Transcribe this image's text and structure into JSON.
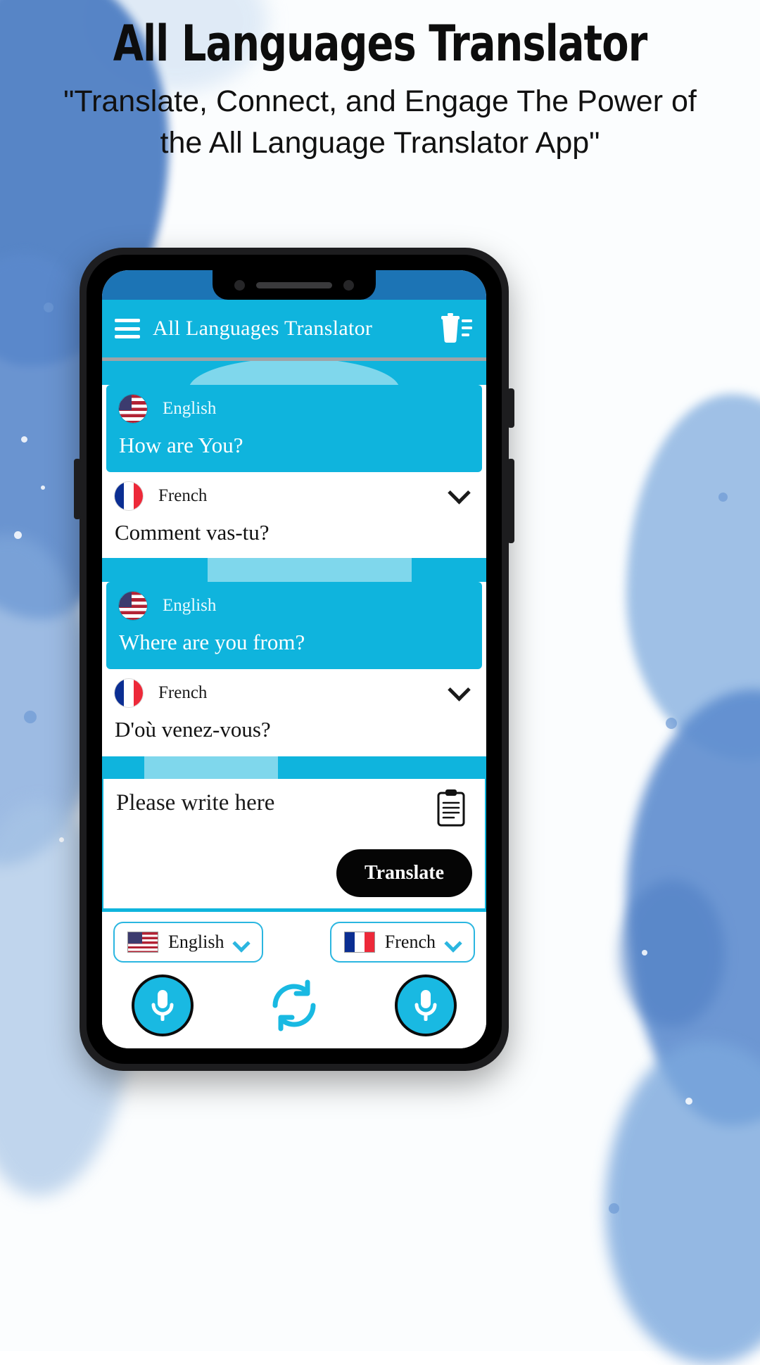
{
  "promo": {
    "title": "All Languages Translator",
    "subtitle": "\"Translate, Connect, and Engage The Power of the All Language Translator App\""
  },
  "app": {
    "bar": {
      "menu_icon": "hamburger-menu-icon",
      "title": "All Languages Translator",
      "delete_all_icon": "trash-list-icon"
    },
    "history": [
      {
        "source": {
          "flag": "us-flag-icon",
          "language": "English",
          "text": "How are You?"
        },
        "target": {
          "flag": "fr-flag-icon",
          "language": "French",
          "text": "Comment vas-tu?",
          "expand_icon": "chevron-down-icon"
        }
      },
      {
        "source": {
          "flag": "us-flag-icon",
          "language": "English",
          "text": "Where are you from?"
        },
        "target": {
          "flag": "fr-flag-icon",
          "language": "French",
          "text": "D'où venez-vous?",
          "expand_icon": "chevron-down-icon"
        },
        "actions": [
          {
            "name": "speak-button",
            "icon": "speaker-head-icon"
          },
          {
            "name": "copy-button",
            "icon": "copy-icon"
          },
          {
            "name": "share-button",
            "icon": "share-icon"
          },
          {
            "name": "delete-button",
            "icon": "trash-icon"
          }
        ]
      }
    ],
    "input": {
      "placeholder": "Please write here",
      "value": "",
      "paste_icon": "clipboard-icon",
      "translate_label": "Translate"
    },
    "bottom": {
      "source_language": "English",
      "source_flag": "us-flag-icon",
      "target_language": "French",
      "target_flag": "fr-flag-icon",
      "dropdown_icon": "chevron-down-icon",
      "mic_source_icon": "microphone-icon",
      "mic_target_icon": "microphone-icon",
      "swap_icon": "swap-arrows-icon"
    }
  },
  "colors": {
    "accent": "#0fb4dd",
    "accent_dark": "#1c74b5",
    "accent_light": "#7fd7ec",
    "button_dark": "#050505"
  }
}
